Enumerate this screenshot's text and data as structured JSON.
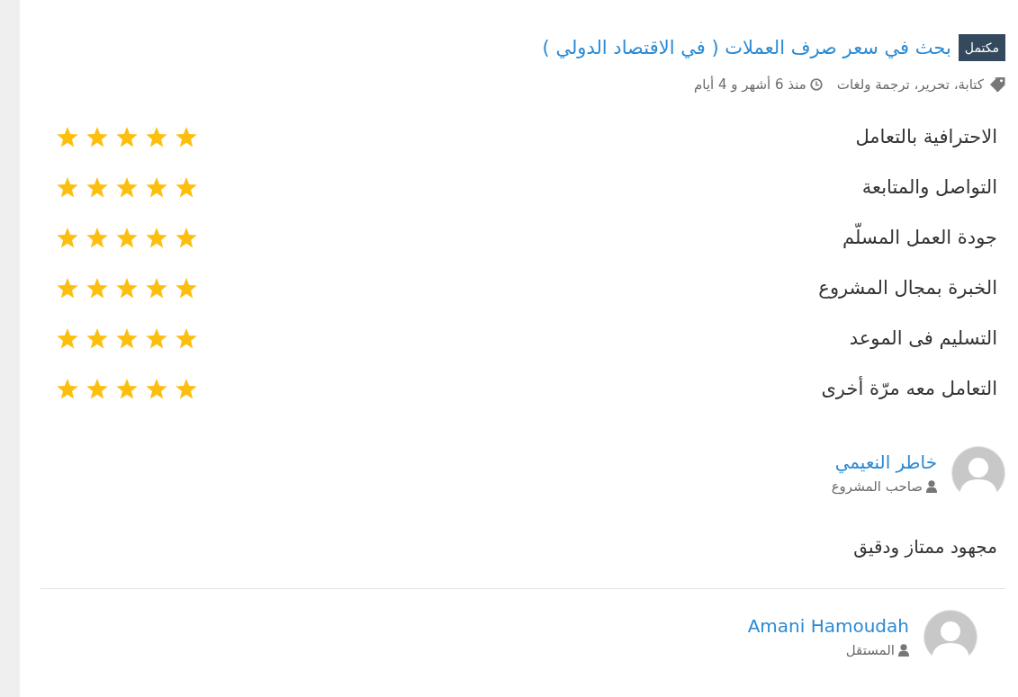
{
  "project": {
    "status": "مكتمل",
    "title": "بحث في سعر صرف العملات ( في الاقتصاد الدولي )",
    "categories": "كتابة، تحرير، ترجمة ولغات",
    "time": "منذ 6 أشهر و 4 أيام"
  },
  "ratings": [
    {
      "label": "الاحترافية بالتعامل",
      "stars": 5
    },
    {
      "label": "التواصل والمتابعة",
      "stars": 5
    },
    {
      "label": "جودة العمل المسلّم",
      "stars": 5
    },
    {
      "label": "الخبرة بمجال المشروع",
      "stars": 5
    },
    {
      "label": "التسليم فى الموعد",
      "stars": 5
    },
    {
      "label": "التعامل معه مرّة أخرى",
      "stars": 5
    }
  ],
  "review": {
    "author": "خاطر النعيمي",
    "role": "صاحب المشروع",
    "comment": "مجهود ممتاز ودقيق"
  },
  "reply": {
    "author": "Amani Hamoudah",
    "role": "المستقل"
  }
}
